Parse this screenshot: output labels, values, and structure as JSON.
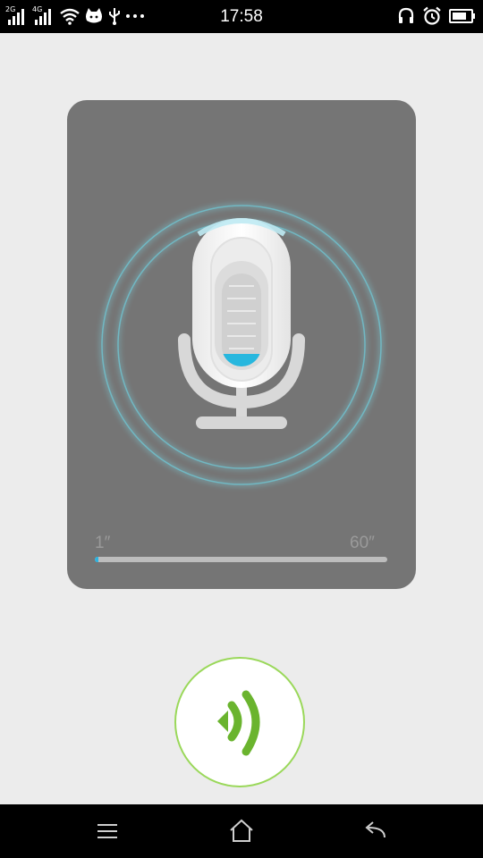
{
  "status_bar": {
    "time": "17:58",
    "network_labels": [
      "2G",
      "4G"
    ],
    "left_icons": [
      "signal-2g-icon",
      "signal-4g-icon",
      "wifi-icon",
      "cat-icon",
      "usb-icon",
      "more-dots-icon"
    ],
    "right_icons": [
      "headset-icon",
      "alarm-icon",
      "battery-icon"
    ]
  },
  "recorder": {
    "start_label": "1″",
    "end_label": "60″",
    "progress": 0.01,
    "accent_color": "#2db3e0",
    "mic_level": 0.1
  },
  "voice_button": {
    "icon": "speaker-waves-icon",
    "color": "#6ab42e"
  },
  "nav_bar": {
    "icons": [
      "menu-icon",
      "home-icon",
      "back-icon"
    ]
  }
}
